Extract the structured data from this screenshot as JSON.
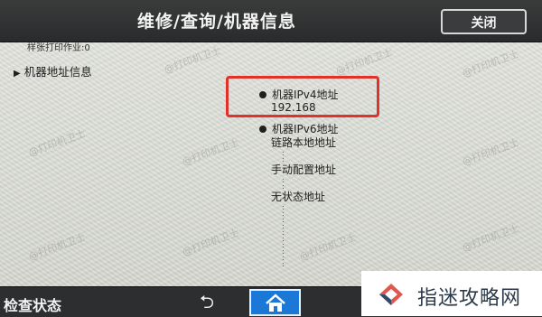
{
  "header": {
    "title": "维修/查询/机器信息",
    "close_label": "关闭"
  },
  "content": {
    "top_partial": "样张打印作业:0",
    "section_title": "机器地址信息",
    "ipv4": {
      "label": "机器IPv4地址",
      "value": "192.168"
    },
    "ipv6": {
      "label": "机器IPv6地址",
      "link_local_label": "链路本地地址",
      "manual_label": "手动配置地址",
      "stateless_label": "无状态地址"
    }
  },
  "footer": {
    "status_label": "检查状态",
    "back_symbol": "⮌"
  },
  "watermark": {
    "text": "@打印机卫士"
  },
  "brand": {
    "name": "指迷攻略网"
  },
  "colors": {
    "highlight": "#e0312b",
    "home_button": "#1b78d6"
  }
}
